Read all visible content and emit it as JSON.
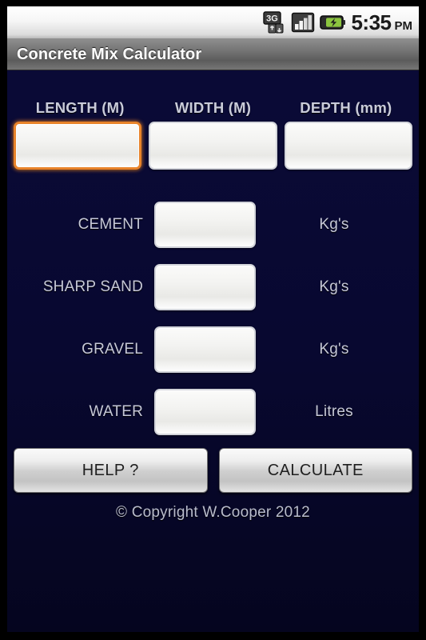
{
  "status_bar": {
    "icons": [
      {
        "name": "3g-data-icon",
        "label": "3G"
      },
      {
        "name": "signal-bars-icon",
        "label": "Signal"
      },
      {
        "name": "battery-charging-icon",
        "label": "Battery"
      }
    ],
    "time": "5:35",
    "meridiem": "PM"
  },
  "title_bar": {
    "title": "Concrete Mix Calculator"
  },
  "dimensions": {
    "fields": [
      {
        "label": "LENGTH (M)",
        "value": "",
        "focused": true
      },
      {
        "label": "WIDTH (M)",
        "value": "",
        "focused": false
      },
      {
        "label": "DEPTH (mm)",
        "value": "",
        "focused": false
      }
    ]
  },
  "results": {
    "rows": [
      {
        "label": "CEMENT",
        "value": "",
        "unit": "Kg's"
      },
      {
        "label": "SHARP SAND",
        "value": "",
        "unit": "Kg's"
      },
      {
        "label": "GRAVEL",
        "value": "",
        "unit": "Kg's"
      },
      {
        "label": "WATER",
        "value": "",
        "unit": "Litres"
      }
    ]
  },
  "buttons": {
    "help": "HELP ?",
    "calculate": "CALCULATE"
  },
  "footer": {
    "copyright": "© Copyright W.Cooper 2012"
  },
  "colors": {
    "background": "#080830",
    "focus_accent": "#e8832a",
    "label_text": "#c6c8d8",
    "title_bar": "#6f6f6f",
    "battery_green": "#8cc63f"
  }
}
